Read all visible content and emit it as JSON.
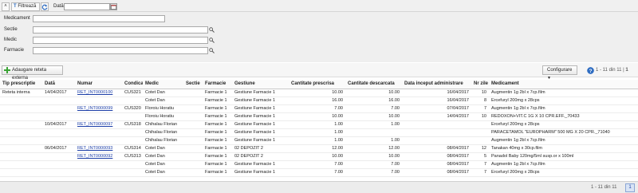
{
  "toolbar": {
    "filter_label": "Filtrează",
    "date_label": "Dată",
    "date_value": ""
  },
  "filters": {
    "medicament_label": "Medicament",
    "sectie_label": "Sectie",
    "medic_label": "Medic",
    "farmacie_label": "Farmacie"
  },
  "actions": {
    "add_label": "Adaugare reteta externa",
    "config_label": "Configurare",
    "pager_text": "1 - 11 din 11",
    "pager_page": "1"
  },
  "table": {
    "headers": [
      "Tip prescriptie",
      "Dată",
      "Numar",
      "Condica",
      "Medic",
      "Sectie",
      "Farmacie",
      "Gestiune",
      "Cantitate prescrisa",
      "Cantitate descarcata",
      "Data inceput administrare",
      "Nr zile",
      "Medicament"
    ],
    "rows": [
      [
        "Reteta interna",
        "14/04/2017",
        "RET_INT0000100",
        "CUS321",
        "Cotet Dan",
        "",
        "Farmacie 1",
        "Gestiune Farmacie 1",
        "10.00",
        "10.00",
        "16/04/2017",
        "10",
        "Augmentin 1g 2bl x 7cp.film"
      ],
      [
        "",
        "",
        "",
        "",
        "Cotet Dan",
        "",
        "Farmacie 1",
        "Gestiune Farmacie 1",
        "16.00",
        "16.00",
        "16/04/2017",
        "8",
        "Ercefuryl 200mg x 28cps"
      ],
      [
        "",
        "",
        "RET_INT0000099",
        "CUS320",
        "Floroiu Horatiu",
        "",
        "Farmacie 1",
        "Gestiune Farmacie 1",
        "7.00",
        "7.00",
        "07/04/2017",
        "7",
        "Augmentin 1g 2bl x 7cp.film"
      ],
      [
        "",
        "",
        "",
        "",
        "Floroiu Horatiu",
        "",
        "Farmacie 1",
        "Gestiune Farmacie 1",
        "10.00",
        "10.00",
        "14/04/2017",
        "10",
        "REDOXON+VIT.C 1G X 10 CPR.EFF._70433"
      ],
      [
        "",
        "10/04/2017",
        "RET_INT0000097",
        "CUS318",
        "Chihalau Florian",
        "",
        "Farmacie 1",
        "Gestiune Farmacie 1",
        "1.00",
        "1.00",
        "",
        "",
        "Ercefuryl 200mg x 28cps"
      ],
      [
        "",
        "",
        "",
        "",
        "Chihalau Florian",
        "",
        "Farmacie 1",
        "Gestiune Farmacie 1",
        "1.00",
        "",
        "",
        "",
        "PARACETAMOL \"EUROPHARM\" 500 MG X 20 CPR._71040"
      ],
      [
        "",
        "",
        "",
        "",
        "Chihalau Florian",
        "",
        "Farmacie 1",
        "Gestiune Farmacie 1",
        "1.00",
        "1.00",
        "",
        "",
        "Augmentin 1g 2bl x 7cp.film"
      ],
      [
        "",
        "06/04/2017",
        "RET_INT0000093",
        "CUS314",
        "Cotet Dan",
        "",
        "Farmacie 1",
        "02 DEPOZIT 2",
        "12.00",
        "12.00",
        "08/04/2017",
        "12",
        "Tanakan 40mg x 30cp.film"
      ],
      [
        "",
        "",
        "RET_INT0000092",
        "CUS313",
        "Cotet Dan",
        "",
        "Farmacie 1",
        "02 DEPOZIT 2",
        "10.00",
        "10.00",
        "08/04/2017",
        "5",
        "Panadol Baby 120mg/5ml susp.or x 100ml"
      ],
      [
        "",
        "",
        "",
        "",
        "Cotet Dan",
        "",
        "Farmacie 1",
        "Gestiune Farmacie 1",
        "7.00",
        "7.00",
        "08/04/2017",
        "7",
        "Augmentin 1g 2bl x 7cp.film"
      ],
      [
        "",
        "",
        "",
        "",
        "Cotet Dan",
        "",
        "Farmacie 1",
        "Gestiune Farmacie 1",
        "7.00",
        "7.00",
        "08/04/2017",
        "7",
        "Ercefuryl 200mg x 28cps"
      ]
    ]
  },
  "footer": {
    "pager_text": "1 - 11 din 11",
    "page": "1"
  },
  "colors": {
    "accent": "#1d3fa8",
    "add_icon": "#3aa335",
    "help_icon": "#2f6dc2"
  }
}
